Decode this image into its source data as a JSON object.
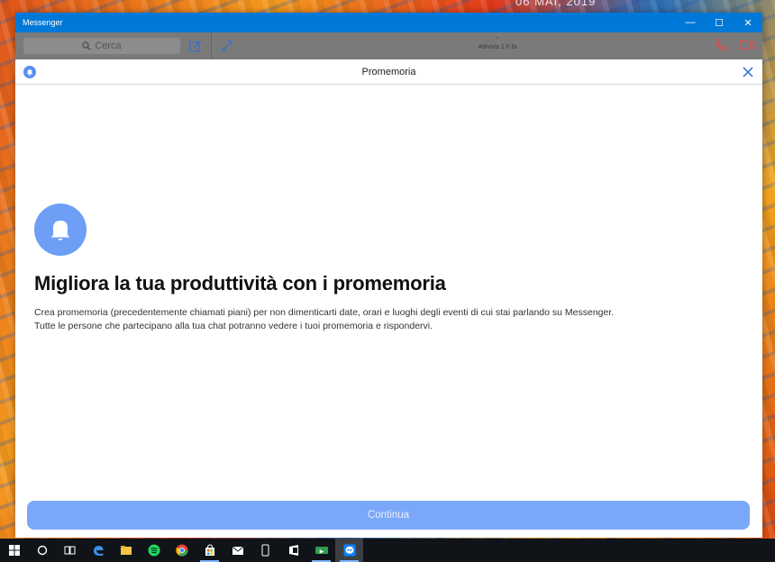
{
  "wallpaper": {
    "date_text": "06 MAI, 2019"
  },
  "window": {
    "title": "Messenger",
    "controls": {
      "minimize": "—",
      "maximize": "☐",
      "close": "✕"
    }
  },
  "toolbar": {
    "search_placeholder": "Cerca",
    "contact_chevron": "›",
    "contact_status": "Attivo/a 1 h fa"
  },
  "modal": {
    "title": "Promemoria",
    "headline": "Migliora la tua produttività con i promemoria",
    "description_line1": "Crea promemoria (precedentemente chiamati piani) per non dimenticarti date, orari e luoghi degli eventi di cui stai parlando su Messenger.",
    "description_line2": "Tutte le persone che partecipano alla tua chat potranno vedere i tuoi promemoria e rispondervi.",
    "continue_label": "Continua"
  },
  "colors": {
    "accent": "#0078d7",
    "bell_blue": "#6e9ef5",
    "button_blue": "#7ba7f8",
    "call_red": "#e04a4a"
  },
  "taskbar": {
    "apps": [
      "start-icon",
      "cortana-icon",
      "task-view-icon",
      "edge-icon",
      "file-explorer-icon",
      "spotify-icon",
      "chrome-icon",
      "store-icon",
      "mail-icon",
      "phone-icon",
      "onenote-icon",
      "xbox-icon",
      "messenger-icon"
    ]
  }
}
